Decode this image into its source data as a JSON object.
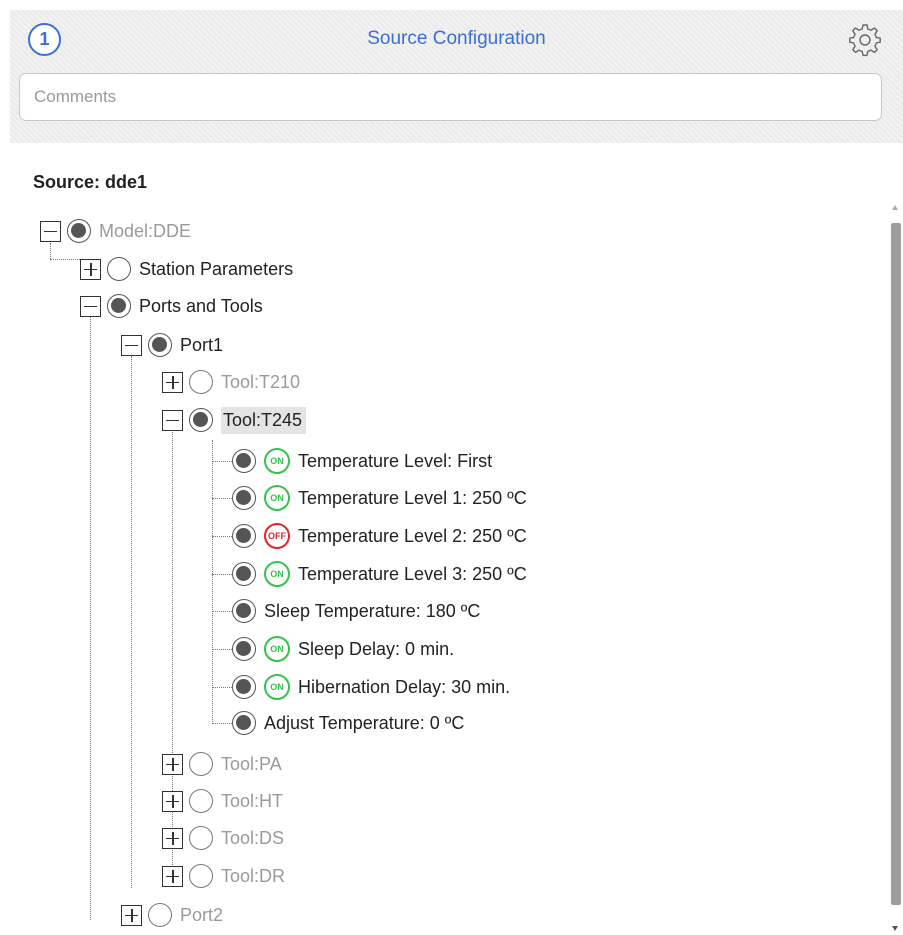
{
  "header": {
    "step_number": "1",
    "title": "Source Configuration",
    "comments_placeholder": "Comments"
  },
  "source_label": "Source: dde1",
  "tree": {
    "model": "Model:DDE",
    "station_parameters": "Station Parameters",
    "ports_and_tools": "Ports and Tools",
    "port1": "Port1",
    "tool_t210": "Tool:T210",
    "tool_t245": "Tool:T245",
    "params": [
      {
        "label": "Temperature Level: First",
        "status": "ON"
      },
      {
        "label": "Temperature Level 1: 250 ºC",
        "status": "ON"
      },
      {
        "label": "Temperature Level 2: 250 ºC",
        "status": "OFF"
      },
      {
        "label": "Temperature Level 3: 250 ºC",
        "status": "ON"
      },
      {
        "label": "Sleep Temperature: 180 ºC",
        "status": ""
      },
      {
        "label": "Sleep Delay: 0 min.",
        "status": "ON"
      },
      {
        "label": "Hibernation Delay: 30 min.",
        "status": "ON"
      },
      {
        "label": "Adjust Temperature: 0 ºC",
        "status": ""
      }
    ],
    "tool_pa": "Tool:PA",
    "tool_ht": "Tool:HT",
    "tool_ds": "Tool:DS",
    "tool_dr": "Tool:DR",
    "port2": "Port2"
  },
  "colors": {
    "accent": "#3a6fd8",
    "on": "#34c24a",
    "off": "#e0252b"
  }
}
